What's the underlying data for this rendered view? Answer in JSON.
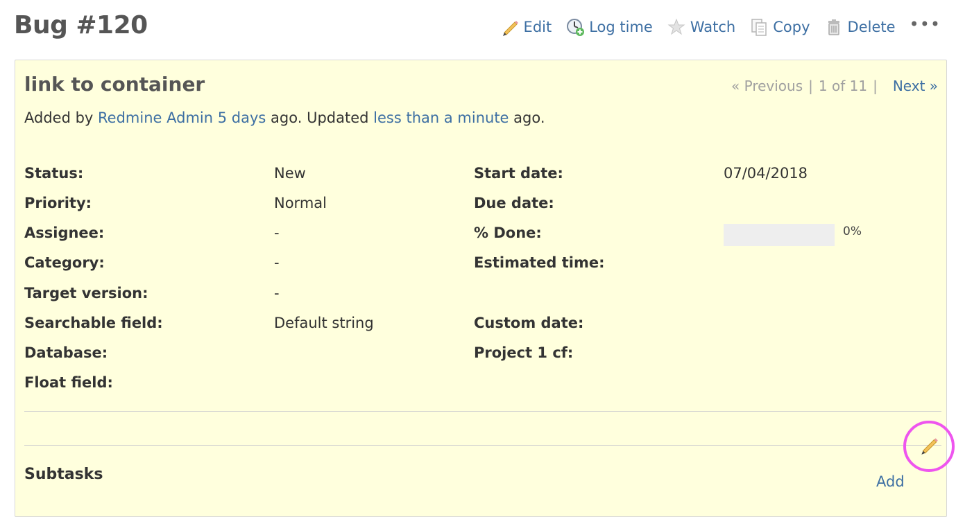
{
  "page": {
    "title": "Bug #120"
  },
  "actions": {
    "edit": {
      "label": "Edit",
      "icon": "pencil-icon"
    },
    "log_time": {
      "label": "Log time",
      "icon": "clock-add-icon"
    },
    "watch": {
      "label": "Watch",
      "icon": "star-icon"
    },
    "copy": {
      "label": "Copy",
      "icon": "copy-icon"
    },
    "delete": {
      "label": "Delete",
      "icon": "trash-icon"
    },
    "more": {
      "label": "•••",
      "icon": "ellipsis-icon"
    }
  },
  "issue": {
    "subject": "link to container",
    "nav": {
      "previous": "« Previous",
      "position": "1 of 11",
      "separator": "|",
      "next": "Next »"
    },
    "author_line": {
      "prefix": "Added by",
      "author": "Redmine Admin",
      "created": "5 days",
      "mid": "ago. Updated",
      "updated": "less than a minute",
      "suffix": "ago."
    },
    "attributes_left": [
      {
        "label": "Status:",
        "value": "New"
      },
      {
        "label": "Priority:",
        "value": "Normal"
      },
      {
        "label": "Assignee:",
        "value": "-"
      },
      {
        "label": "Category:",
        "value": "-"
      },
      {
        "label": "Target version:",
        "value": "-"
      },
      {
        "label": "Searchable field:",
        "value": "Default string"
      },
      {
        "label": "Database:",
        "value": ""
      },
      {
        "label": "Float field:",
        "value": ""
      }
    ],
    "attributes_right": {
      "start_date": {
        "label": "Start date:",
        "value": "07/04/2018"
      },
      "due_date": {
        "label": "Due date:",
        "value": ""
      },
      "done_ratio": {
        "label": "% Done:",
        "value": "0%",
        "fraction": 0
      },
      "estimated_time": {
        "label": "Estimated time:",
        "value": ""
      },
      "custom_date": {
        "label": "Custom date:",
        "value": ""
      },
      "project_cf": {
        "label": "Project 1 cf:",
        "value": ""
      }
    },
    "description_edit_icon": "pencil-icon",
    "subtasks": {
      "title": "Subtasks",
      "add_label": "Add"
    }
  },
  "colors": {
    "link": "#3d6fa3",
    "box_background": "#ffffdd",
    "highlight_ring": "#ee55ee"
  }
}
